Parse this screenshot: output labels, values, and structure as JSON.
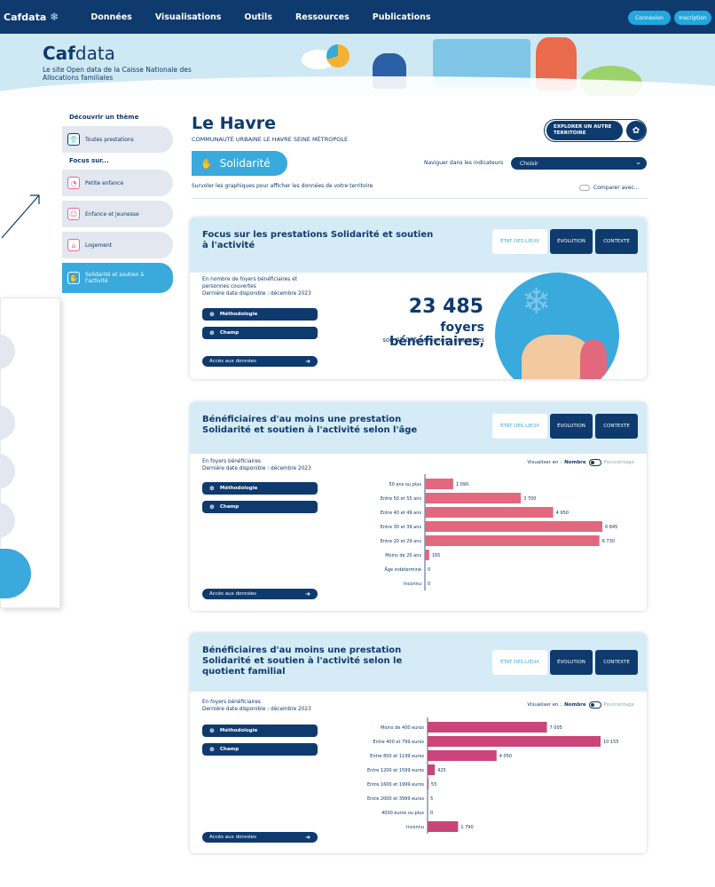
{
  "nav": {
    "logo": "Cafdata",
    "items": [
      "Données",
      "Visualisations",
      "Outils",
      "Ressources",
      "Publications"
    ],
    "btn_login": "Connexion",
    "btn_register": "Inscription"
  },
  "banner": {
    "brand_bold": "Caf",
    "brand_rest": "data",
    "subtitle": "Le site Open data de la Caisse Nationale des Allocations familiales"
  },
  "sidebar": {
    "title": "Découvrir un thème",
    "all": "Toutes prestations",
    "focus_title": "Focus sur...",
    "items": [
      {
        "label": "Petite enfance",
        "icon": "baby-icon"
      },
      {
        "label": "Enfance et jeunesse",
        "icon": "children-icon"
      },
      {
        "label": "Logement",
        "icon": "house-icon"
      },
      {
        "label": "Solidarité et soutien à l'activité",
        "icon": "hands-icon"
      }
    ]
  },
  "header": {
    "city": "Le Havre",
    "city_sub": "COMMUNAUTÉ URBAINE LE HAVRE SEINE MÉTROPOLE",
    "explore": "EXPLORER UN AUTRE TERRITOIRE",
    "theme": "Solidarité",
    "navig_label": "Naviguer dans les indicateurs",
    "select_value": "Choisir",
    "hint": "Survoler les graphiques pour afficher les données de votre territoire",
    "compare": "Comparer avec..."
  },
  "tabs": {
    "etat": "ÉTAT DES LIEUX",
    "evo": "ÉVOLUTION",
    "ctx": "CONTEXTE"
  },
  "buttons": {
    "methodo": "Méthodologie",
    "champ": "Champ",
    "data": "Accès aux données"
  },
  "card1": {
    "title": "Focus sur les prestations Solidarité et soutien à l'activité",
    "meta": "En nombre de foyers bénéficiaires et personnes couvertes",
    "date": "Dernière date disponible : décembre 2023",
    "big_num": "23 485",
    "big_lbl": "foyers bénéficiaires,",
    "big_sub": "soit 47 075 personnes couvertes"
  },
  "card2": {
    "title": "Bénéficiaires d'au moins une prestation Solidarité et soutien à l'activité selon l'âge",
    "meta": "En foyers bénéficiaires",
    "date": "Dernière date disponible : décembre 2023",
    "viz_label": "Visualiser en :",
    "viz_on": "Nombre",
    "viz_off": "Pourcentage"
  },
  "card3": {
    "title": "Bénéficiaires d'au moins une prestation Solidarité et soutien à l'activité selon le quotient familial",
    "meta": "En foyers bénéficiaires",
    "date": "Dernière date disponible : décembre 2023",
    "viz_label": "Visualiser en :",
    "viz_on": "Nombre",
    "viz_off": "Pourcentage"
  },
  "chart_data": [
    {
      "type": "bar",
      "orientation": "horizontal",
      "color": "#e2687e",
      "categories": [
        "50 ans ou plus",
        "Entre 50 et 55 ans",
        "Entre 40 et 49 ans",
        "Entre 30 et 39 ans",
        "Entre 20 et 29 ans",
        "Moins de 20 ans",
        "Âge indéterminé",
        "Inconnu"
      ],
      "values": [
        1090,
        3700,
        4950,
        6845,
        6730,
        165,
        0,
        0
      ],
      "labels": [
        "1 090",
        "3 700",
        "4 950",
        "6 845",
        "6 730",
        "165",
        "0",
        "0"
      ]
    },
    {
      "type": "bar",
      "orientation": "horizontal",
      "color": "#c9457a",
      "categories": [
        "Moins de 400 euros",
        "Entre 400 et 799 euros",
        "Entre 800 et 1199 euros",
        "Entre 1200 et 1599 euros",
        "Entre 1600 et 1999 euros",
        "Entre 2000 et 3999 euros",
        "4000 euros ou plus",
        "Inconnu"
      ],
      "values": [
        7005,
        10155,
        4050,
        425,
        55,
        5,
        0,
        1790
      ],
      "labels": [
        "7 005",
        "10 155",
        "4 050",
        "425",
        "55",
        "5",
        "0",
        "1 790"
      ]
    }
  ]
}
